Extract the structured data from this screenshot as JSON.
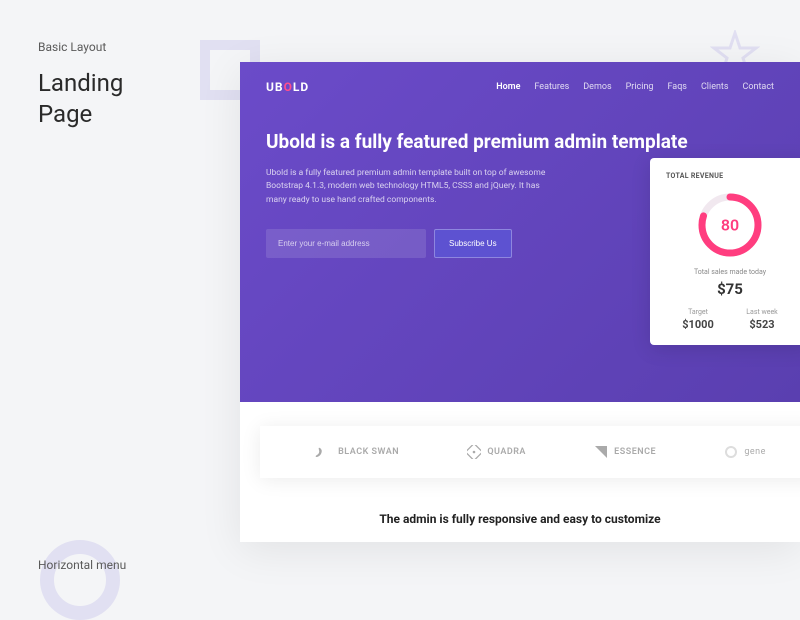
{
  "meta": {
    "category": "Basic Layout",
    "title_line1": "Landing",
    "title_line2": "Page",
    "footer": "Horizontal menu"
  },
  "logo": {
    "part1": "UB",
    "accent": "O",
    "part2": "LD"
  },
  "nav": {
    "items": [
      {
        "label": "Home",
        "active": true
      },
      {
        "label": "Features",
        "active": false
      },
      {
        "label": "Demos",
        "active": false
      },
      {
        "label": "Pricing",
        "active": false
      },
      {
        "label": "Faqs",
        "active": false
      },
      {
        "label": "Clients",
        "active": false
      },
      {
        "label": "Contact",
        "active": false
      }
    ]
  },
  "hero": {
    "headline": "Ubold is a fully featured premium admin template",
    "body": "Ubold is a fully featured premium admin template built on top of awesome Bootstrap 4.1.3, modern web technology HTML5, CSS3 and jQuery. It has many ready to use hand crafted components.",
    "email_placeholder": "Enter your e-mail address",
    "subscribe_label": "Subscribe Us"
  },
  "widget": {
    "title": "TOTAL REVENUE",
    "gauge_value": "80",
    "subtitle": "Total sales made today",
    "amount": "$75",
    "target_label": "Target",
    "target_value": "$1000",
    "lastweek_label": "Last week",
    "lastweek_value": "$523"
  },
  "brands": [
    {
      "name": "BLACK SWAN",
      "icon": "swan"
    },
    {
      "name": "QUADRA",
      "icon": "square"
    },
    {
      "name": "ESSENCE",
      "icon": "flag"
    },
    {
      "name": "gene",
      "icon": "circle"
    }
  ],
  "section_heading": "The admin is fully responsive and easy to customize",
  "colors": {
    "accent_pink": "#ff3d7f",
    "hero_bg": "#6b4bc9"
  }
}
